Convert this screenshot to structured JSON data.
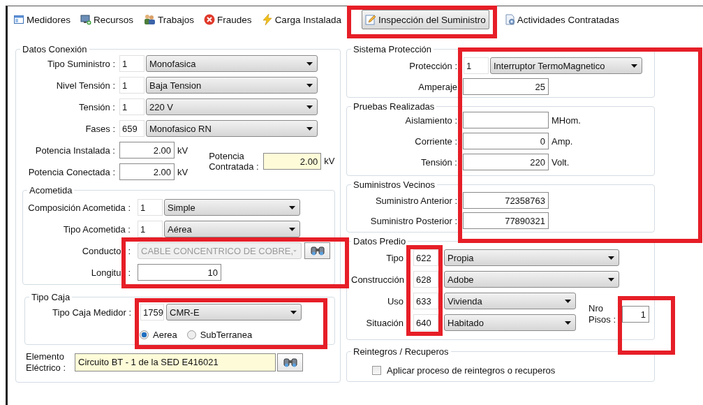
{
  "tabs": [
    {
      "label": "Medidores",
      "selected": false
    },
    {
      "label": "Recursos",
      "selected": false
    },
    {
      "label": "Trabajos",
      "selected": false
    },
    {
      "label": "Fraudes",
      "selected": false
    },
    {
      "label": "Carga Instalada",
      "selected": false
    },
    {
      "label": "Inspección del Suministro",
      "selected": true
    },
    {
      "label": "Actividades Contratadas",
      "selected": false
    }
  ],
  "datos_conexion": {
    "title": "Datos Conexión",
    "rows": [
      {
        "label": "Tipo Suministro :",
        "code": "1",
        "value": "Monofasica"
      },
      {
        "label": "Nivel Tensión :",
        "code": "1",
        "value": "Baja Tension"
      },
      {
        "label": "Tensión :",
        "code": "1",
        "value": "220 V"
      },
      {
        "label": "Fases :",
        "code": "659",
        "value": "Monofasico RN"
      }
    ],
    "potencia_instalada": {
      "label": "Potencia Instalada :",
      "value": "2.00",
      "unit": "kV"
    },
    "potencia_conectada": {
      "label": "Potencia Conectada :",
      "value": "2.00",
      "unit": "kV"
    },
    "potencia_contratada": {
      "label": "Potencia Contratada :",
      "value": "2.00",
      "unit": "kV"
    }
  },
  "acometida": {
    "title": "Acometida",
    "rows": [
      {
        "label": "Composición Acometida :",
        "code": "1",
        "value": "Simple"
      },
      {
        "label": "Tipo Acometida :",
        "code": "1",
        "value": "Aérea"
      }
    ],
    "conductor": {
      "label": "Conducto",
      "colon": ":",
      "value": "CABLE CONCENTRICO DE COBRE,",
      "disabled": true
    },
    "longitud": {
      "label": "Longitu",
      "colon": ":",
      "value": "10"
    }
  },
  "tipo_caja": {
    "title": "Tipo Caja",
    "label": "Tipo Caja Medidor :",
    "code": "1759",
    "value": "CMR-E",
    "options": [
      {
        "label": "Aerea",
        "selected": true
      },
      {
        "label": "SubTerranea",
        "selected": false
      }
    ]
  },
  "elemento_electrico": {
    "label": "Elemento Eléctrico :",
    "value": "Circuito BT - 1 de la SED E416021"
  },
  "sistema_proteccion": {
    "title": "Sistema Protección",
    "proteccion": {
      "label": "Protección :",
      "code": "1",
      "value": "Interruptor TermoMagnetico"
    },
    "amperaje": {
      "label": "Amperaje",
      "value": "25"
    }
  },
  "pruebas_realizadas": {
    "title": "Pruebas Realizadas",
    "rows": [
      {
        "label": "Aislamiento :",
        "unit": "MHom."
      },
      {
        "label": "Corriente :",
        "value": "0",
        "unit": "Amp."
      },
      {
        "label": "Tensión :",
        "value": "220",
        "unit": "Volt."
      }
    ]
  },
  "suministros_vecinos": {
    "title": "Suministros Vecinos",
    "rows": [
      {
        "label": "Suministro Anterior :",
        "value": "72358763"
      },
      {
        "label": "Suministro Posterior :",
        "value": "77890321"
      }
    ]
  },
  "datos_predio": {
    "title": "Datos Predio",
    "rows": [
      {
        "label": "Tipo",
        "code": "622",
        "value": "Propia"
      },
      {
        "label": "Construcción",
        "code": "628",
        "value": "Adobe"
      },
      {
        "label": "Uso",
        "code": "633",
        "value": "Vivienda"
      },
      {
        "label": "Situación",
        "code": "640",
        "value": "Habitado"
      }
    ],
    "nro_pisos": {
      "label": "Nro Pisos :",
      "value": "1"
    }
  },
  "reintegros": {
    "title": "Reintegros / Recuperos",
    "checkbox": {
      "label": "Aplicar proceso de reintegros o recuperos",
      "checked": false
    }
  }
}
